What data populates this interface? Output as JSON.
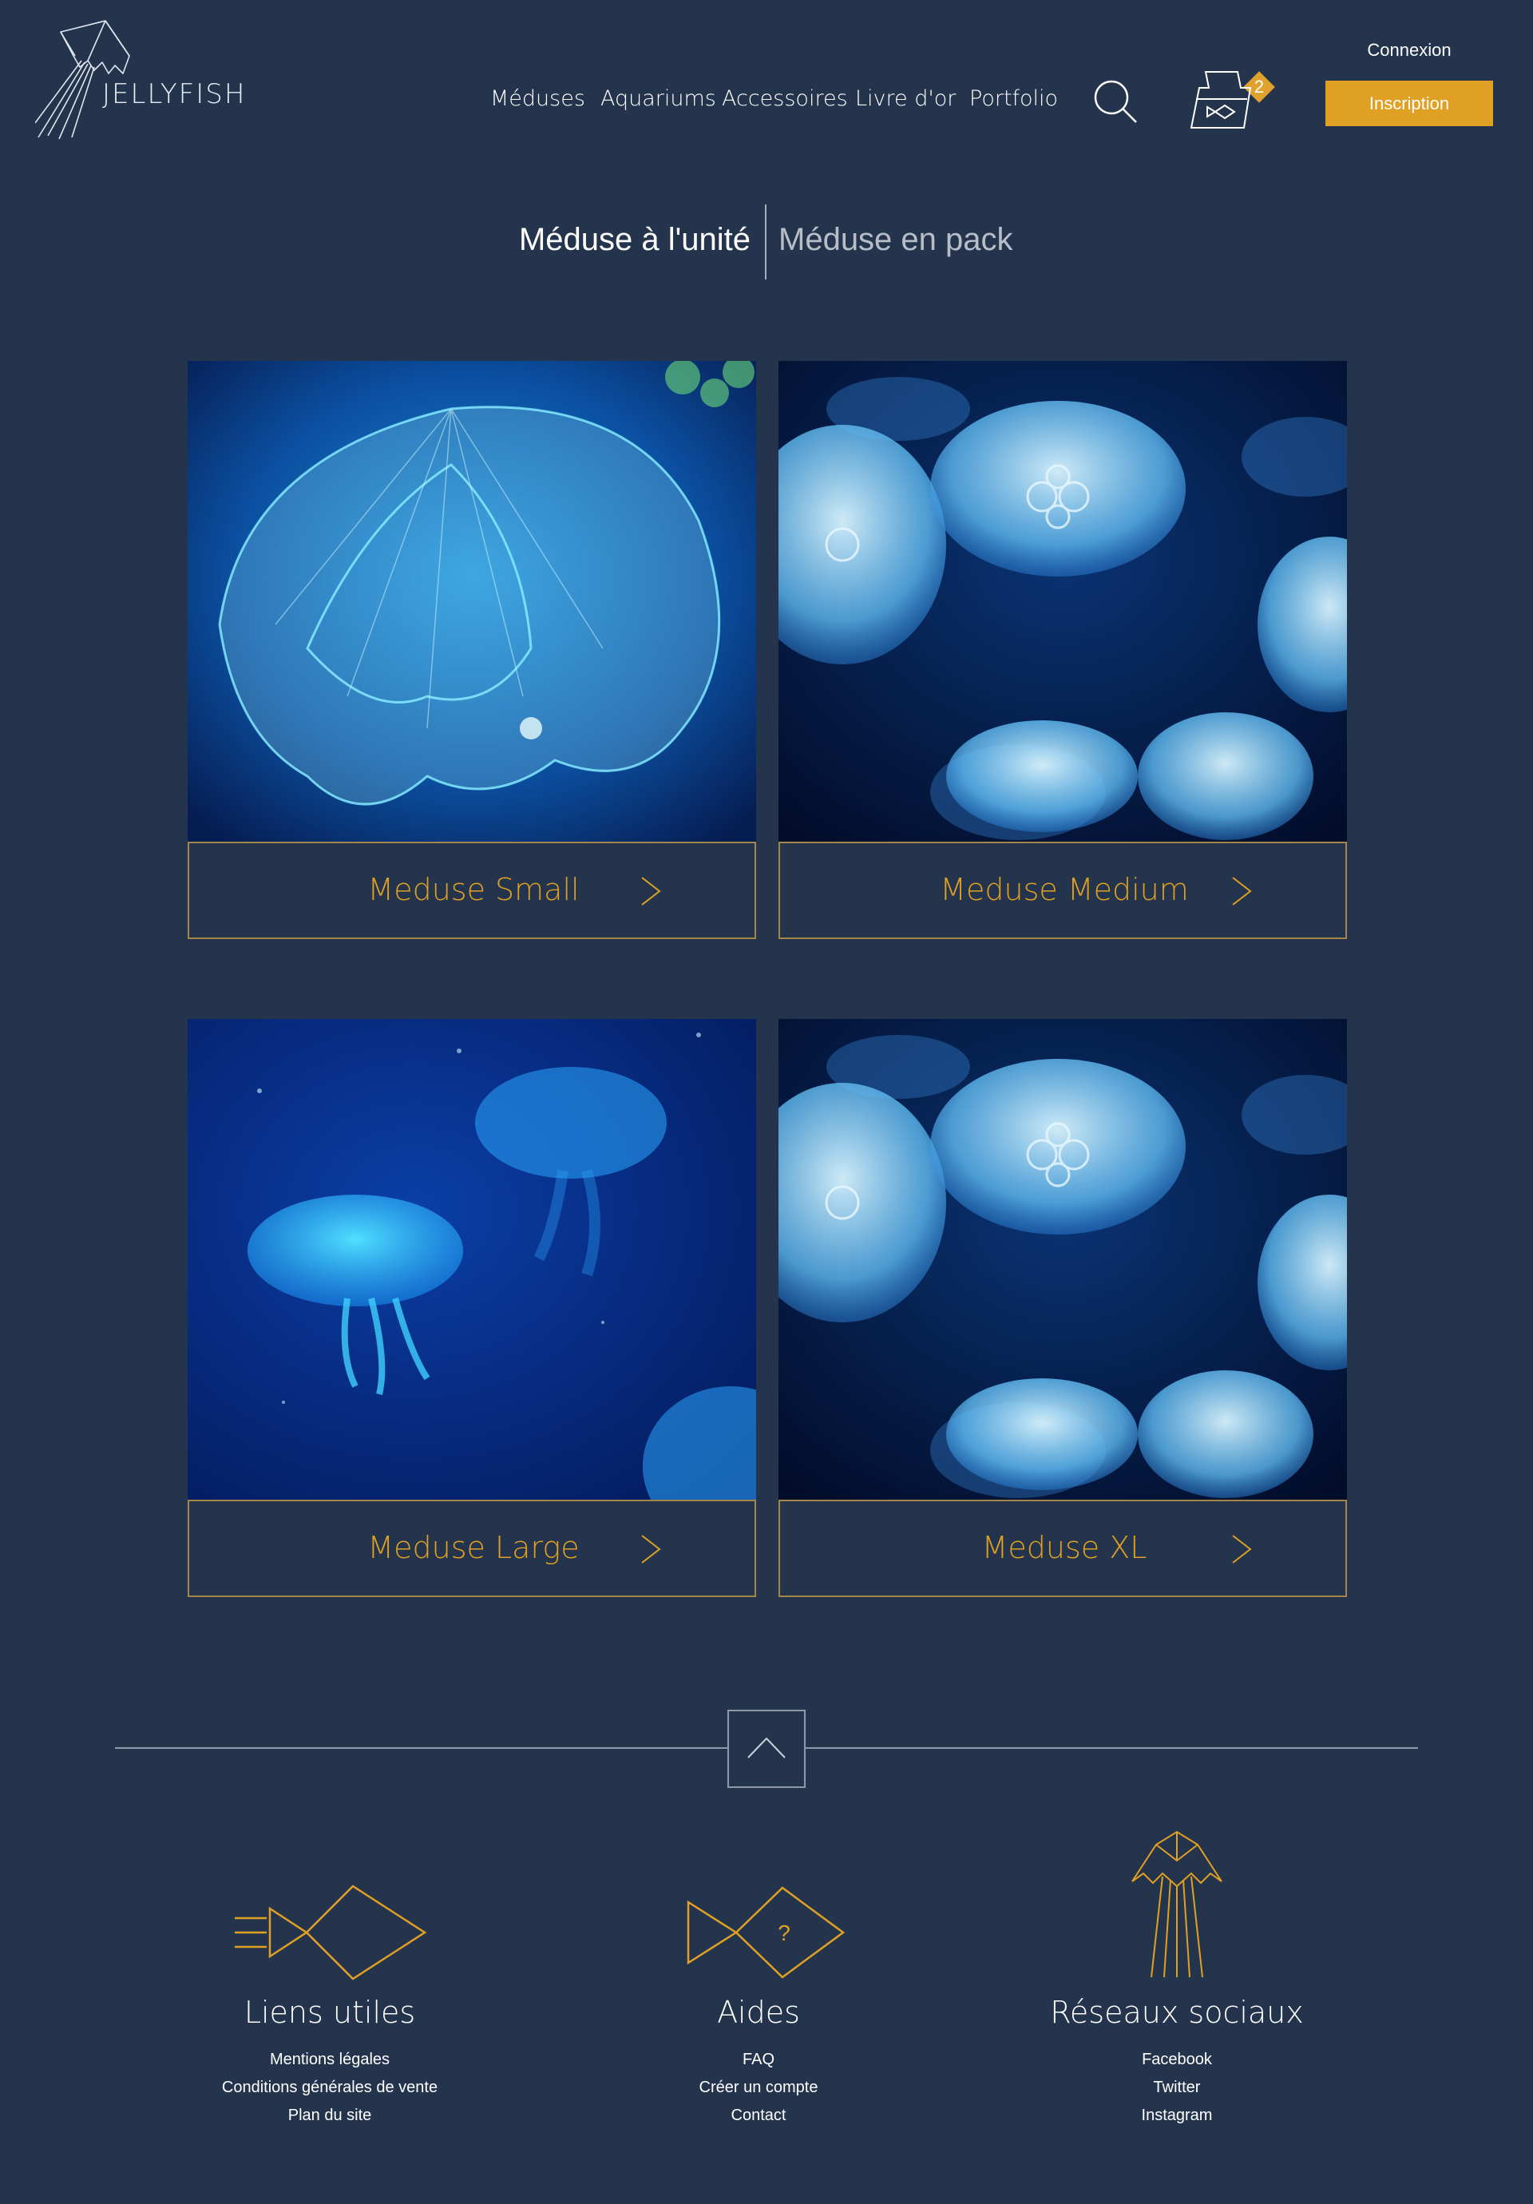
{
  "header": {
    "logo_text": "JELLYFISH",
    "nav": [
      "Méduses",
      "Aquariums",
      "Accessoires",
      "Livre d'or",
      "Portfolio"
    ],
    "cart_count": "2",
    "connexion_label": "Connexion",
    "inscription_label": "Inscription"
  },
  "tabs": {
    "active": "Méduse à l'unité",
    "inactive": "Méduse en pack"
  },
  "products": [
    {
      "name": "Meduse Small"
    },
    {
      "name": "Meduse Medium"
    },
    {
      "name": "Meduse Large"
    },
    {
      "name": "Meduse XL"
    }
  ],
  "footer": {
    "columns": [
      {
        "title": "Liens utiles",
        "links": [
          "Mentions légales",
          "Conditions générales de vente",
          "Plan du site"
        ]
      },
      {
        "title": "Aides",
        "links": [
          "FAQ",
          "Créer un compte",
          "Contact"
        ]
      },
      {
        "title": "Réseaux sociaux",
        "links": [
          "Facebook",
          "Twitter",
          "Instagram"
        ]
      }
    ],
    "help_icon_glyph": "?"
  },
  "colors": {
    "background": "#24344c",
    "accent": "#dfa024",
    "card_border": "#a3864a"
  },
  "icons": [
    "jellyfish-logo-icon",
    "search-icon",
    "aquarium-cart-icon",
    "chevron-right-icon",
    "arrow-up-icon",
    "fish-icon",
    "fish-help-icon",
    "jellyfish-icon"
  ]
}
